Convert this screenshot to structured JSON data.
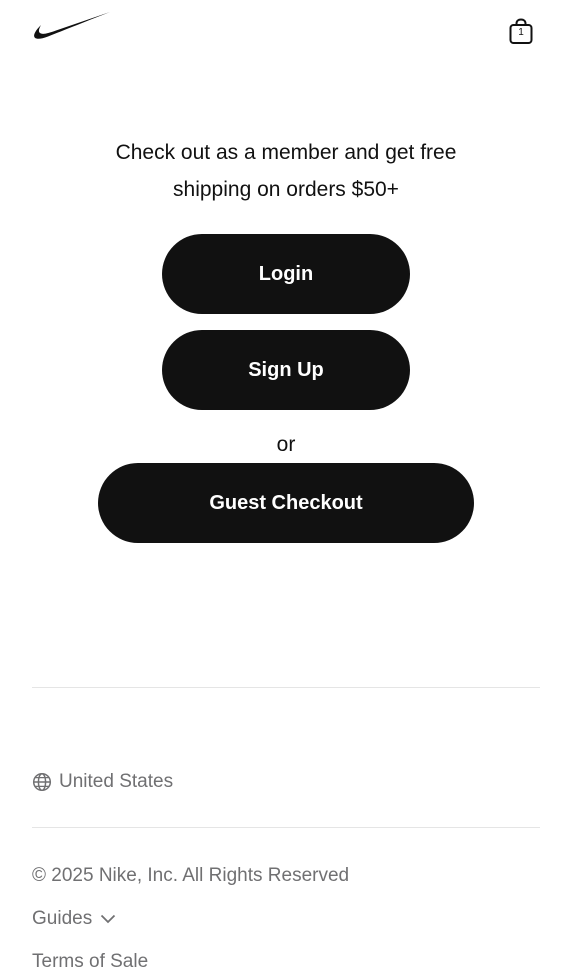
{
  "header": {
    "logo_icon": "nike-swoosh-icon",
    "bag": {
      "icon": "shopping-bag-icon",
      "count": "1"
    }
  },
  "main": {
    "promo_text": "Check out as a member and get free shipping on orders $50+",
    "login_label": "Login",
    "signup_label": "Sign Up",
    "or_text": "or",
    "guest_checkout_label": "Guest Checkout"
  },
  "footer": {
    "locale_icon": "globe-icon",
    "locale_label": "United States",
    "copyright": "© 2025 Nike, Inc. All Rights Reserved",
    "guides_label": "Guides",
    "guides_icon": "chevron-down-icon",
    "terms_label": "Terms of Sale",
    "text_color": "#707072"
  },
  "colors": {
    "button_background": "#111111",
    "button_text": "#ffffff",
    "divider": "#e5e5e5"
  }
}
